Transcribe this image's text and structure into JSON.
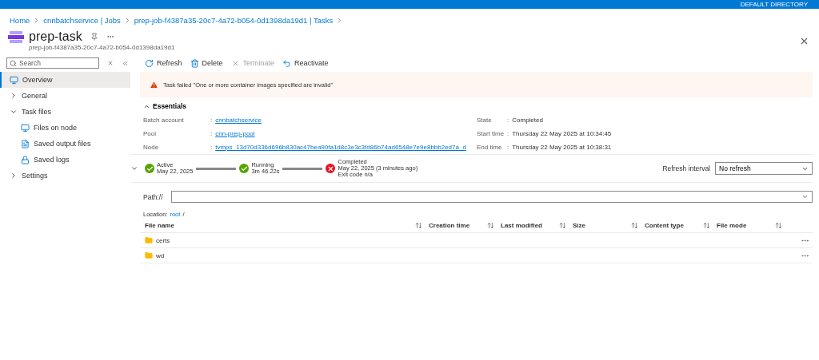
{
  "top_bar": {
    "directory": "DEFAULT DIRECTORY"
  },
  "breadcrumb": [
    "Home",
    "cnnbatchservice | Jobs",
    "prep-job-f4387a35-20c7-4a72-b054-0d1398da19d1 | Tasks"
  ],
  "header": {
    "title": "prep-task",
    "subtitle": "prep-job-f4387a35-20c7-4a72-b054-0d1398da19d1"
  },
  "sidebar": {
    "search": {
      "placeholder": "Search"
    },
    "items": [
      {
        "label": "Overview",
        "kind": "page",
        "selected": true
      },
      {
        "label": "General",
        "kind": "group",
        "expanded": false,
        "selected": false
      },
      {
        "label": "Task files",
        "kind": "group",
        "expanded": true,
        "selected": false,
        "children": [
          {
            "label": "Files on node",
            "selected": false
          },
          {
            "label": "Saved output files",
            "selected": false
          },
          {
            "label": "Saved logs",
            "selected": false
          }
        ]
      },
      {
        "label": "Settings",
        "kind": "group",
        "expanded": false,
        "selected": false
      }
    ]
  },
  "toolbar": [
    {
      "label": "Refresh",
      "kind": "refresh",
      "disabled": false
    },
    {
      "label": "Delete",
      "kind": "delete",
      "disabled": false
    },
    {
      "label": "Terminate",
      "kind": "terminate",
      "disabled": true
    },
    {
      "label": "Reactivate",
      "kind": "reactivate",
      "disabled": false
    }
  ],
  "alert": {
    "text": "Task failed \"One or more container images specified are invalid\""
  },
  "essentials": {
    "title": "Essentials",
    "expanded": true,
    "left": [
      {
        "label": "Batch account",
        "separator": ":",
        "value": "cnnbatchservice",
        "link": true
      },
      {
        "label": "Pool",
        "separator": ":",
        "value": "cnn-prep-pool",
        "link": true
      },
      {
        "label": "Node",
        "separator": ":",
        "value": "tvmps_13d70d336d696b830ac47bea90fa1d8c3e3c3fd86b74ad6548e7e9e8bbb2ed7a_d",
        "link": true
      }
    ],
    "right": [
      {
        "label": "State",
        "separator": ":",
        "value": "Completed",
        "link": false
      },
      {
        "label": "Start time",
        "separator": ":",
        "value": "Thursday 22 May 2025 at 10:34:45",
        "link": false
      },
      {
        "label": "End time",
        "separator": ":",
        "value": "Thursday 22 May 2025 at 10:38:31",
        "link": false
      }
    ]
  },
  "timeline": {
    "steps": [
      {
        "kind": "success",
        "lines": [
          "Active",
          "May 22, 2025"
        ]
      },
      {
        "kind": "success",
        "lines": [
          "Running",
          "3m 46.22s"
        ]
      },
      {
        "kind": "failed",
        "lines": [
          "Completed",
          "May 22, 2025 (3 minutes ago)",
          "Exit code n/a"
        ]
      }
    ],
    "refresh_interval": {
      "label": "Refresh interval",
      "value": "No refresh"
    }
  },
  "path": {
    "label": "Path://"
  },
  "location": {
    "label": "Location:",
    "link": "root",
    "suffix": "/"
  },
  "table": {
    "columns": [
      "File name",
      "Creation time",
      "Last modified",
      "Size",
      "Content type",
      "File mode"
    ],
    "rows": [
      {
        "name": "certs"
      },
      {
        "name": "wd"
      }
    ]
  }
}
